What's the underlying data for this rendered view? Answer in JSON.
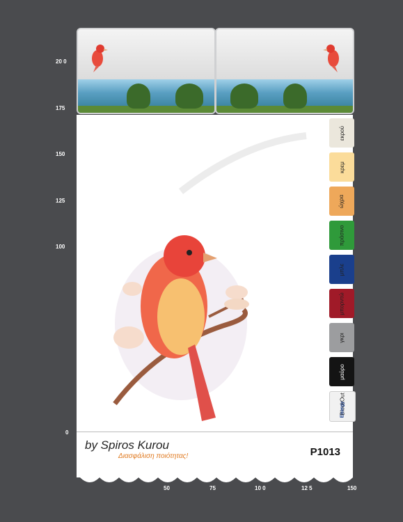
{
  "vertical_scale": [
    "20 0",
    "175",
    "150",
    "125",
    "100",
    "0"
  ],
  "horizontal_scale": [
    "50",
    "75",
    "10 0",
    "12 5",
    "150"
  ],
  "colors": [
    {
      "label": "εκρού",
      "hex": "#ebe7dc"
    },
    {
      "label": "κρεμ",
      "hex": "#fbdc9a"
    },
    {
      "label": "ώχρα",
      "hex": "#eea85a"
    },
    {
      "label": "πράσινο",
      "hex": "#2f9a3a"
    },
    {
      "label": "μπλε",
      "hex": "#1a3f8c"
    },
    {
      "label": "μπορντώ",
      "hex": "#a01a28"
    },
    {
      "label": "γκρι",
      "hex": "#9c9d9f"
    },
    {
      "label": "μαύρο",
      "hex": "#141414"
    }
  ],
  "blockout": {
    "label": "BlockOut",
    "brand": "Energy"
  },
  "brand": {
    "name": "by Spiros Kurou",
    "tagline": "Διασφάλιση ποιότητας!"
  },
  "product_code": "P1013"
}
